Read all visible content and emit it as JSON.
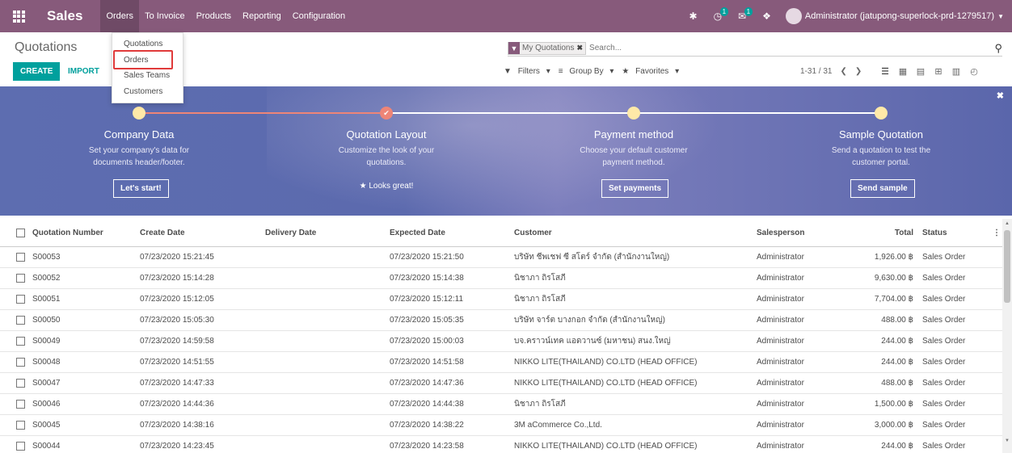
{
  "navbar": {
    "app_name": "Sales",
    "menu": [
      "Orders",
      "To Invoice",
      "Products",
      "Reporting",
      "Configuration"
    ],
    "activity_badge": "1",
    "messages_badge": "1",
    "user": "Administrator (jatupong-superlock-prd-1279517)"
  },
  "orders_menu": {
    "items": [
      "Quotations",
      "Orders",
      "Sales Teams",
      "Customers"
    ],
    "highlighted": "Orders"
  },
  "control_panel": {
    "breadcrumb": "Quotations",
    "create_label": "CREATE",
    "import_label": "IMPORT",
    "facet": "My Quotations",
    "search_placeholder": "Search...",
    "filters_label": "Filters",
    "groupby_label": "Group By",
    "favorites_label": "Favorites",
    "pager": "1-31 / 31"
  },
  "onboarding": {
    "steps": [
      {
        "title": "Company Data",
        "desc_line1": "Set your company's data for",
        "desc_line2": "documents header/footer.",
        "action": "Let's start!",
        "done": false
      },
      {
        "title": "Quotation Layout",
        "desc_line1": "Customize the look of your",
        "desc_line2": "quotations.",
        "action": "Looks great!",
        "done": true
      },
      {
        "title": "Payment method",
        "desc_line1": "Choose your default customer",
        "desc_line2": "payment method.",
        "action": "Set payments",
        "done": false
      },
      {
        "title": "Sample Quotation",
        "desc_line1": "Send a quotation to test the",
        "desc_line2": "customer portal.",
        "action": "Send sample",
        "done": false
      }
    ],
    "colors": {
      "done_line": "#ee8577",
      "pending_line": "#ffffff",
      "dot": "#ffe9a8"
    }
  },
  "table": {
    "headers": {
      "number": "Quotation Number",
      "create_date": "Create Date",
      "delivery_date": "Delivery Date",
      "expected_date": "Expected Date",
      "customer": "Customer",
      "salesperson": "Salesperson",
      "total": "Total",
      "status": "Status"
    },
    "rows": [
      {
        "number": "S00053",
        "create_date": "07/23/2020 15:21:45",
        "delivery_date": "",
        "expected_date": "07/23/2020 15:21:50",
        "customer": "บริษัท ชีพเชฟ ซี สโตร์ จำกัด (สำนักงานใหญ่)",
        "salesperson": "Administrator",
        "total": "1,926.00 ฿",
        "status": "Sales Order"
      },
      {
        "number": "S00052",
        "create_date": "07/23/2020 15:14:28",
        "delivery_date": "",
        "expected_date": "07/23/2020 15:14:38",
        "customer": "นิชาภา ถิรโสภี",
        "salesperson": "Administrator",
        "total": "9,630.00 ฿",
        "status": "Sales Order"
      },
      {
        "number": "S00051",
        "create_date": "07/23/2020 15:12:05",
        "delivery_date": "",
        "expected_date": "07/23/2020 15:12:11",
        "customer": "นิชาภา ถิรโสภี",
        "salesperson": "Administrator",
        "total": "7,704.00 ฿",
        "status": "Sales Order"
      },
      {
        "number": "S00050",
        "create_date": "07/23/2020 15:05:30",
        "delivery_date": "",
        "expected_date": "07/23/2020 15:05:35",
        "customer": "บริษัท จาร์ต บางกอก จำกัด (สำนักงานใหญ่)",
        "salesperson": "Administrator",
        "total": "488.00 ฿",
        "status": "Sales Order"
      },
      {
        "number": "S00049",
        "create_date": "07/23/2020 14:59:58",
        "delivery_date": "",
        "expected_date": "07/23/2020 15:00:03",
        "customer": "บจ.คราวน์เทค แอดวานซ์ (มหาชน) สนง.ใหญ่",
        "salesperson": "Administrator",
        "total": "244.00 ฿",
        "status": "Sales Order"
      },
      {
        "number": "S00048",
        "create_date": "07/23/2020 14:51:55",
        "delivery_date": "",
        "expected_date": "07/23/2020 14:51:58",
        "customer": "NIKKO LITE(THAILAND) CO.LTD (HEAD OFFICE)",
        "salesperson": "Administrator",
        "total": "244.00 ฿",
        "status": "Sales Order"
      },
      {
        "number": "S00047",
        "create_date": "07/23/2020 14:47:33",
        "delivery_date": "",
        "expected_date": "07/23/2020 14:47:36",
        "customer": "NIKKO LITE(THAILAND) CO.LTD (HEAD OFFICE)",
        "salesperson": "Administrator",
        "total": "488.00 ฿",
        "status": "Sales Order"
      },
      {
        "number": "S00046",
        "create_date": "07/23/2020 14:44:36",
        "delivery_date": "",
        "expected_date": "07/23/2020 14:44:38",
        "customer": "นิชาภา ถิรโสภี",
        "salesperson": "Administrator",
        "total": "1,500.00 ฿",
        "status": "Sales Order"
      },
      {
        "number": "S00045",
        "create_date": "07/23/2020 14:38:16",
        "delivery_date": "",
        "expected_date": "07/23/2020 14:38:22",
        "customer": "3M aCommerce Co.,Ltd.",
        "salesperson": "Administrator",
        "total": "3,000.00 ฿",
        "status": "Sales Order"
      },
      {
        "number": "S00044",
        "create_date": "07/23/2020 14:23:45",
        "delivery_date": "",
        "expected_date": "07/23/2020 14:23:58",
        "customer": "NIKKO LITE(THAILAND) CO.LTD (HEAD OFFICE)",
        "salesperson": "Administrator",
        "total": "244.00 ฿",
        "status": "Sales Order"
      }
    ]
  },
  "colors": {
    "brand": "#875a7b",
    "accent": "#00a09d",
    "highlight_box": "#e03a3a"
  }
}
